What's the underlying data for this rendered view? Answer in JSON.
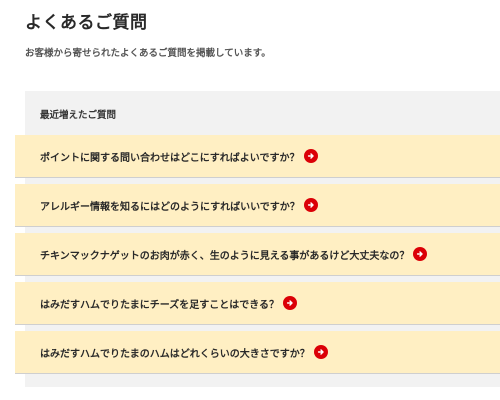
{
  "header": {
    "title": "よくあるご質問",
    "subtitle": "お客様から寄せられたよくあるご質問を掲載しています。"
  },
  "faq_section": {
    "heading": "最近増えたご質問",
    "items": [
      {
        "label": "ポイントに関する問い合わせはどこにすればよいですか？",
        "icon": "arrow-right-circle-icon"
      },
      {
        "label": "アレルギー情報を知るにはどのようにすればいいですか？",
        "icon": "arrow-right-circle-icon"
      },
      {
        "label": "チキンマックナゲットのお肉が赤く、生のように見える事があるけど大丈夫なの？",
        "icon": "arrow-right-circle-icon"
      },
      {
        "label": "はみだすハムでりたまにチーズを足すことはできる？",
        "icon": "arrow-right-circle-icon"
      },
      {
        "label": "はみだすハムでりたまのハムはどれくらいの大きさですか？",
        "icon": "arrow-right-circle-icon"
      }
    ]
  },
  "colors": {
    "item_background": "#ffefc3",
    "panel_background": "#f2f2f2",
    "icon_red": "#db0007"
  }
}
